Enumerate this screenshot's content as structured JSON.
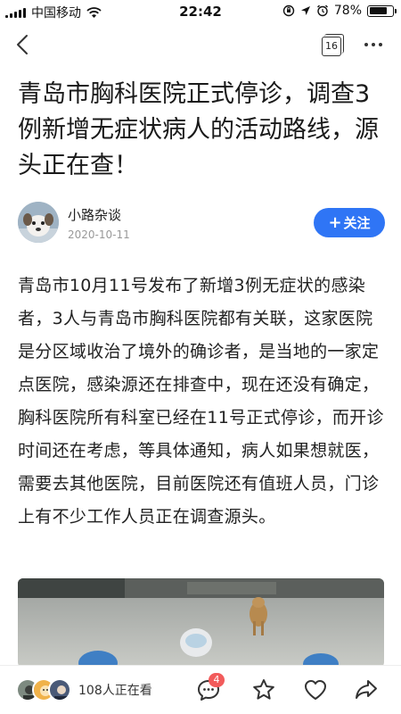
{
  "status_bar": {
    "carrier": "中国移动",
    "time": "22:42",
    "battery_text": "78%",
    "battery_level": 0.78
  },
  "nav": {
    "count": "16",
    "icons": [
      "back-arrow-icon",
      "page-count-icon",
      "more-icon"
    ]
  },
  "article": {
    "title": "青岛市胸科医院正式停诊，调查3例新增无症状病人的活动路线，源头正在查！",
    "body": "青岛市10月11号发布了新增3例无症状的感染者，3人与青岛市胸科医院都有关联，这家医院是分区域收治了境外的确诊者，是当地的一家定点医院，感染源还在排查中，现在还没有确定，胸科医院所有科室已经在11号正式停诊，而开诊时间还在考虑，等具体通知，病人如果想就医，需要去其他医院，目前医院还有值班人员，门诊上有不少工作人员正在调查源头。"
  },
  "author": {
    "name": "小路杂谈",
    "date": "2020-10-11",
    "follow_label": "关注"
  },
  "bottom_bar": {
    "viewers_text": "108人正在看",
    "comment_badge": "4",
    "icons": [
      "comment-icon",
      "star-icon",
      "heart-icon",
      "share-icon"
    ]
  },
  "colors": {
    "accent": "#2f75f5",
    "badge": "#f25b5b"
  }
}
